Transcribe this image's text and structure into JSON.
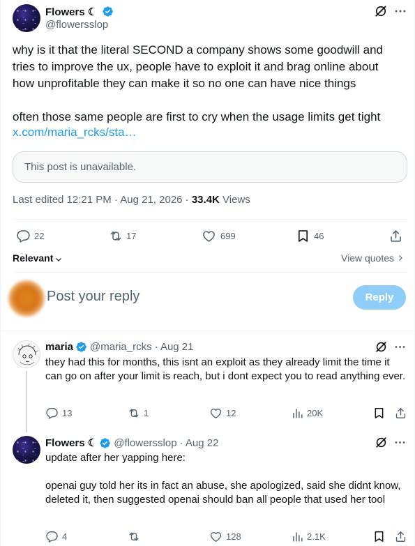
{
  "main_tweet": {
    "author_name": "Flowers ☾",
    "handle": "@flowersslop",
    "text": "why is it that the literal SECOND a company shows some goodwill and tries to improve the ux, people have to exploit it and brag online about how unprofitable they can make it so no one can have nice things\n\noften those same people are first to cry when the usage limits get tight",
    "link": "x.com/maria_rcks/sta…",
    "quote_unavailable": "This post is unavailable.",
    "edited_label": "Last edited 12:21 PM · Aug 21, 2026 · ",
    "views_count": "33.4K",
    "views_label": " Views",
    "replies": "22",
    "reposts": "17",
    "likes": "699",
    "bookmarks": "46"
  },
  "sort": {
    "label": "Relevant",
    "view_quotes": "View quotes"
  },
  "composer": {
    "placeholder": "Post your reply",
    "button": "Reply"
  },
  "replies": [
    {
      "author_name": "maria",
      "handle": "@maria_rcks",
      "date": "· Aug 21",
      "text": "they had this for months, this isnt an exploit as they already limit the time it can go on after your limit is reach, but i dont expect you to read anything ever.",
      "replies": "13",
      "reposts": "1",
      "likes": "12",
      "views": "20K"
    },
    {
      "author_name": "Flowers ☾",
      "handle": "@flowersslop",
      "date": "· Aug 22",
      "text": "update after her yapping here:\n\nopenai guy told her its in fact an abuse, she apologized, said she didnt know, deleted it, then suggested openai should ban all people that used her tool",
      "replies": "4",
      "reposts": "",
      "likes": "128",
      "views": "2.1K"
    }
  ],
  "colors": {
    "accent": "#1d9bf0",
    "text": "#0f1419",
    "muted": "#536471",
    "border": "#eff3f4",
    "reply_button": "#8ecdf8"
  },
  "icons": [
    "verified-badge-icon",
    "grok-icon",
    "more-icon",
    "reply-icon",
    "repost-icon",
    "like-icon",
    "bookmark-icon",
    "share-icon",
    "views-icon",
    "chevron-down-icon",
    "chevron-right-icon"
  ]
}
